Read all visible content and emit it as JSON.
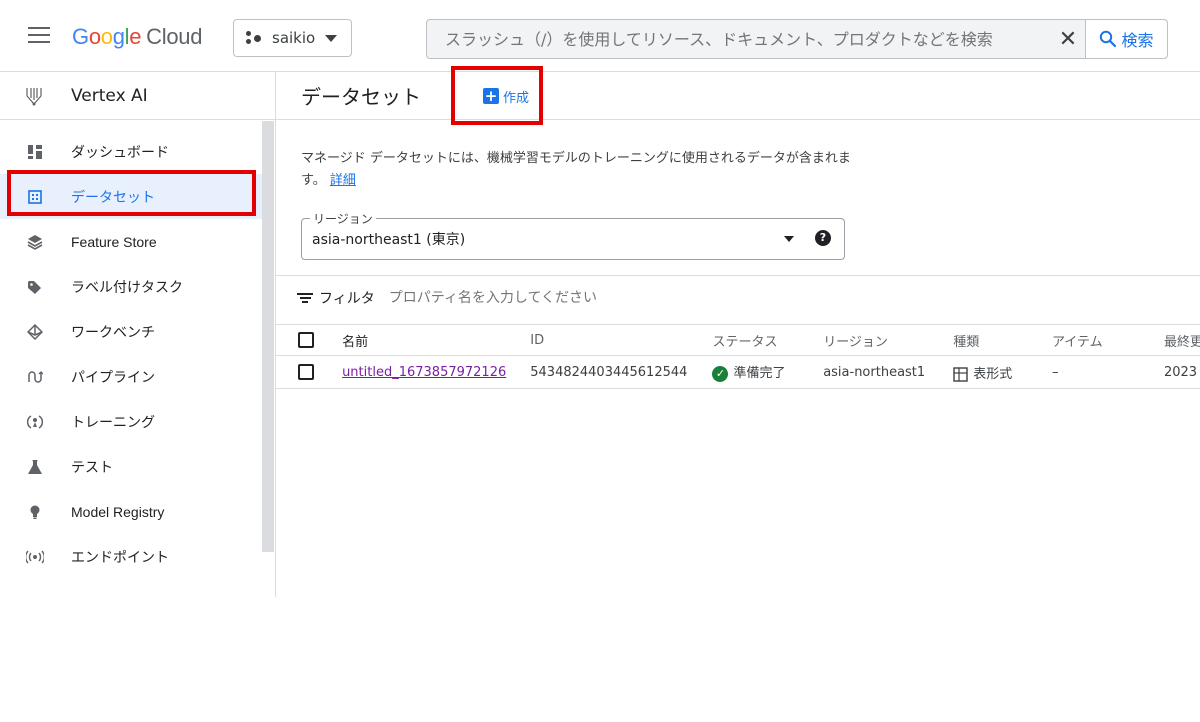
{
  "header": {
    "logo_letters": [
      "G",
      "o",
      "o",
      "g",
      "l",
      "e"
    ],
    "logo_cloud": "Cloud",
    "project": "saikio",
    "search_placeholder": "スラッシュ（/）を使用してリソース、ドキュメント、プロダクトなどを検索",
    "clear_symbol": "✕",
    "search_button": "検索"
  },
  "sidebar": {
    "title": "Vertex AI",
    "items": [
      {
        "label": "ダッシュボード",
        "icon": "dashboard-icon",
        "active": false
      },
      {
        "label": "データセット",
        "icon": "dataset-icon",
        "active": true
      },
      {
        "label": "Feature Store",
        "icon": "feature-store-icon",
        "active": false
      },
      {
        "label": "ラベル付けタスク",
        "icon": "label-tag-icon",
        "active": false
      },
      {
        "label": "ワークベンチ",
        "icon": "workbench-icon",
        "active": false
      },
      {
        "label": "パイプライン",
        "icon": "pipeline-icon",
        "active": false
      },
      {
        "label": "トレーニング",
        "icon": "training-icon",
        "active": false
      },
      {
        "label": "テスト",
        "icon": "flask-icon",
        "active": false
      },
      {
        "label": "Model Registry",
        "icon": "bulb-icon",
        "active": false
      },
      {
        "label": "エンドポイント",
        "icon": "endpoint-icon",
        "active": false
      }
    ]
  },
  "main": {
    "title": "データセット",
    "create_label": "作成",
    "description": "マネージド データセットには、機械学習モデルのトレーニングに使用されるデータが含まれます。",
    "details_link": "詳細",
    "region": {
      "label": "リージョン",
      "value": "asia-northeast1 (東京)"
    },
    "filter": {
      "label": "フィルタ",
      "placeholder": "プロパティ名を入力してください"
    },
    "table": {
      "headers": [
        "名前",
        "ID",
        "ステータス",
        "リージョン",
        "種類",
        "アイテム",
        "最終更新"
      ],
      "rows": [
        {
          "name": "untitled_1673857972126",
          "id": "5434824403445612544",
          "status": "準備完了",
          "region": "asia-northeast1",
          "type": "表形式",
          "items": "–",
          "updated": "2023"
        }
      ]
    }
  },
  "colors": {
    "accent": "#1a73e8",
    "highlight_box": "#e30000",
    "status_ok": "#188038",
    "link_visited": "#7b1fa2"
  }
}
